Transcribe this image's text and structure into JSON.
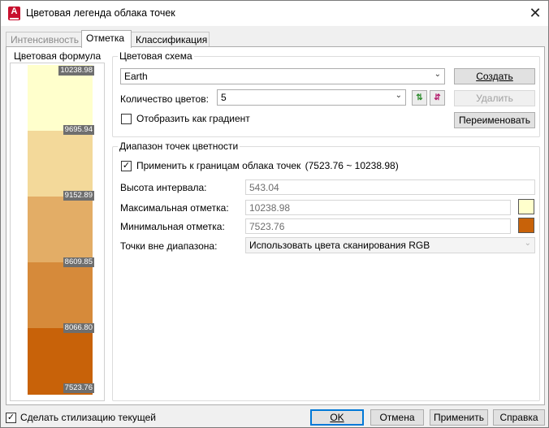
{
  "window": {
    "title": "Цветовая легенда облака точек",
    "close_glyph": "✕"
  },
  "tabs": [
    {
      "label": "Интенсивность",
      "state": "disabled"
    },
    {
      "label": "Отметка",
      "state": "active"
    },
    {
      "label": "Классификация",
      "state": "normal"
    }
  ],
  "formula": {
    "title": "Цветовая формула",
    "bands": [
      {
        "color": "#ffffcc"
      },
      {
        "color": "#f3d99a"
      },
      {
        "color": "#e3ad66"
      },
      {
        "color": "#d68a3a"
      },
      {
        "color": "#c86209"
      }
    ],
    "marks": [
      "10238.98",
      "9695.94",
      "9152.89",
      "8609.85",
      "8066.80",
      "7523.76"
    ]
  },
  "scheme": {
    "group_title": "Цветовая схема",
    "selected": "Earth",
    "count_label": "Количество цветов:",
    "count_value": "5",
    "gradient_label": "Отобразить как градиент",
    "gradient_checked": false,
    "create_label": "Создать",
    "delete_label": "Удалить",
    "rename_label": "Переименовать"
  },
  "range": {
    "group_title": "Диапазон точек цветности",
    "apply_label": "Применить к границам облака точек",
    "apply_range": "(7523.76 ~ 10238.98)",
    "apply_checked": true,
    "interval_label": "Высота интервала:",
    "interval_value": "543.04",
    "max_label": "Максимальная отметка:",
    "max_value": "10238.98",
    "max_color": "#ffffcc",
    "min_label": "Минимальная отметка:",
    "min_value": "7523.76",
    "min_color": "#c86209",
    "outside_label": "Точки вне диапазона:",
    "outside_value": "Использовать цвета сканирования RGB"
  },
  "footer": {
    "make_current_label": "Сделать стилизацию текущей",
    "make_current_checked": true,
    "ok_label": "OK",
    "cancel_label": "Отмена",
    "apply_label": "Применить",
    "help_label": "Справка"
  }
}
